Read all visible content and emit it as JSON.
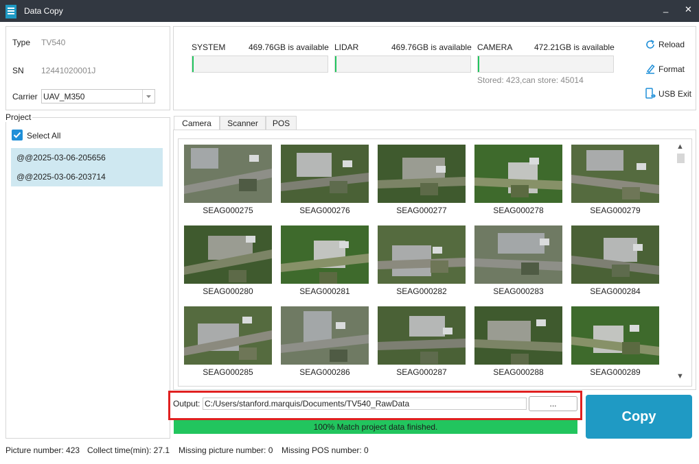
{
  "window": {
    "title": "Data Copy",
    "minimize_glyph": "_",
    "close_glyph": "✕"
  },
  "device": {
    "type_label": "Type",
    "type_value": "TV540",
    "sn_label": "SN",
    "sn_value": "12441020001J",
    "carrier_label": "Carrier",
    "carrier_value": "UAV_M350"
  },
  "project": {
    "section_label": "Project",
    "select_all_label": "Select All",
    "select_all_checked": true,
    "items": [
      "@@2025-03-06-205656",
      "@@2025-03-06-203714"
    ]
  },
  "storage": {
    "drives": [
      {
        "name": "SYSTEM",
        "free": "469.76GB is available"
      },
      {
        "name": "LIDAR",
        "free": "469.76GB is available"
      },
      {
        "name": "CAMERA",
        "free": "472.21GB is available"
      }
    ],
    "stored_info": "Stored: 423,can store: 45014"
  },
  "actions": {
    "reload": "Reload",
    "format": "Format",
    "usb_exit": "USB Exit"
  },
  "tabs": [
    {
      "label": "Camera",
      "active": true
    },
    {
      "label": "Scanner",
      "active": false
    },
    {
      "label": "POS",
      "active": false
    }
  ],
  "thumbnails": [
    "SEAG000275",
    "SEAG000276",
    "SEAG000277",
    "SEAG000278",
    "SEAG000279",
    "SEAG000280",
    "SEAG000281",
    "SEAG000282",
    "SEAG000283",
    "SEAG000284",
    "SEAG000285",
    "SEAG000286",
    "SEAG000287",
    "SEAG000288",
    "SEAG000289"
  ],
  "output": {
    "label": "Output:",
    "path": "C:/Users/stanford.marquis/Documents/TV540_RawData",
    "browse": "..."
  },
  "progress": {
    "text": "100% Match project data finished.",
    "percent": 100
  },
  "copy_label": "Copy",
  "status": {
    "picture_number": "Picture number: 423",
    "collect_time": "Collect time(min): 27.1",
    "missing_picture": "Missing picture number: 0",
    "missing_pos": "Missing POS number: 0"
  },
  "colors": {
    "accent": "#1f9ac4",
    "progress": "#22c55e",
    "highlight": "#e02020",
    "titlebar": "#323841"
  }
}
